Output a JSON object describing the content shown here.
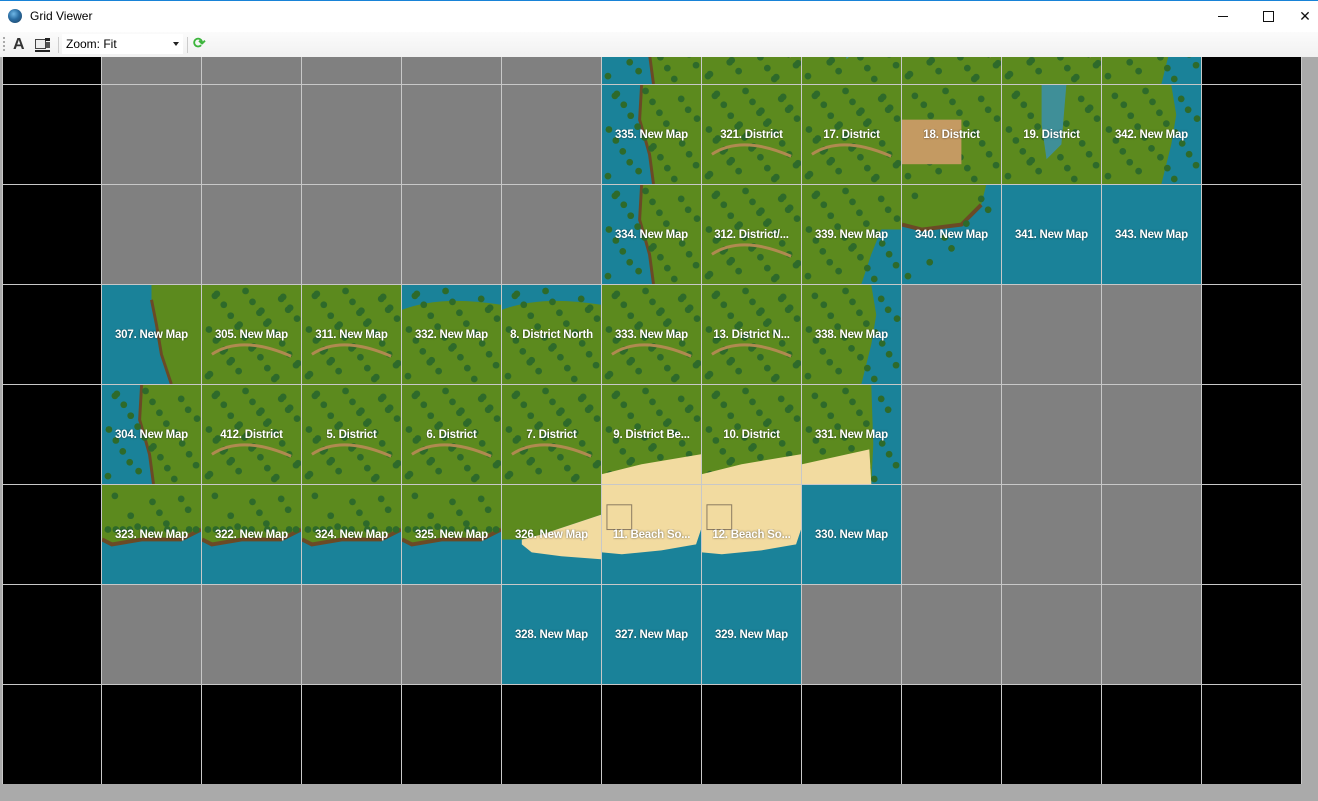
{
  "window": {
    "title": "Grid Viewer",
    "controls": {
      "minimize": "minimize",
      "maximize": "maximize",
      "close": "close"
    }
  },
  "toolbar": {
    "font_button_label": "A",
    "zoom_select_value": "Zoom: Fit",
    "icons": [
      "font-icon",
      "image-layout-icon",
      "refresh-icon"
    ]
  },
  "colors": {
    "title_accent": "#1883d7",
    "empty_cell": "#000000",
    "unused_cell": "#808080",
    "map_water": "#1a8299",
    "grid_line": "#c8c8c8",
    "grass": "#5c8a1e",
    "forest": "#2e6a2a",
    "sand": "#f2dba0",
    "label_text": "#ffffff"
  },
  "grid": {
    "columns": 13,
    "rows": [
      {
        "cells": [
          "black",
          "gray",
          "gray",
          "gray",
          "gray",
          "gray",
          {
            "type": "map",
            "land": "forest-coast-left"
          },
          {
            "type": "map",
            "land": "forest"
          },
          {
            "type": "map",
            "land": "forest-lake"
          },
          {
            "type": "map",
            "land": "forest"
          },
          {
            "type": "map",
            "land": "forest"
          },
          {
            "type": "map",
            "land": "forest-coast-right"
          },
          "black"
        ]
      },
      {
        "cells": [
          "black",
          "gray",
          "gray",
          "gray",
          "gray",
          "gray",
          {
            "type": "map",
            "label": "335. New Map",
            "land": "forest-coast-left"
          },
          {
            "type": "map",
            "label": "321. District",
            "land": "forest"
          },
          {
            "type": "map",
            "label": "17. District",
            "land": "forest"
          },
          {
            "type": "map",
            "label": "18. District",
            "land": "forest-dirt"
          },
          {
            "type": "map",
            "label": "19. District",
            "land": "forest-lake"
          },
          {
            "type": "map",
            "label": "342. New Map",
            "land": "forest-coast-right"
          },
          "black"
        ]
      },
      {
        "cells": [
          "black",
          "gray",
          "gray",
          "gray",
          "gray",
          "gray",
          {
            "type": "map",
            "label": "334. New Map",
            "land": "forest-coast-left"
          },
          {
            "type": "map",
            "label": "312. District/...",
            "land": "forest"
          },
          {
            "type": "map",
            "label": "339. New Map",
            "land": "forest-partial"
          },
          {
            "type": "map",
            "label": "340. New Map",
            "land": "coast-top"
          },
          {
            "type": "map",
            "label": "341. New Map",
            "land": "water"
          },
          {
            "type": "map",
            "label": "343. New Map",
            "land": "water"
          },
          "black"
        ]
      },
      {
        "cells": [
          "black",
          {
            "type": "map",
            "label": "307. New Map",
            "land": "coast-right"
          },
          {
            "type": "map",
            "label": "305. New Map",
            "land": "forest"
          },
          {
            "type": "map",
            "label": "311. New Map",
            "land": "forest"
          },
          {
            "type": "map",
            "label": "332. New Map",
            "land": "forest-coast-top"
          },
          {
            "type": "map",
            "label": "8. District North",
            "land": "forest-coast-top"
          },
          {
            "type": "map",
            "label": "333. New Map",
            "land": "forest"
          },
          {
            "type": "map",
            "label": "13. District N...",
            "land": "forest"
          },
          {
            "type": "map",
            "label": "338. New Map",
            "land": "forest-coast-right"
          },
          "gray",
          "gray",
          "gray",
          "black"
        ]
      },
      {
        "cells": [
          "black",
          {
            "type": "map",
            "label": "304. New Map",
            "land": "forest-coast-left"
          },
          {
            "type": "map",
            "label": "412. District",
            "land": "forest"
          },
          {
            "type": "map",
            "label": "5. District",
            "land": "forest"
          },
          {
            "type": "map",
            "label": "6. District",
            "land": "forest"
          },
          {
            "type": "map",
            "label": "7. District",
            "land": "forest"
          },
          {
            "type": "map",
            "label": "9. District Be...",
            "land": "forest-sand-bottom"
          },
          {
            "type": "map",
            "label": "10. District",
            "land": "forest-sand-bottom"
          },
          {
            "type": "map",
            "label": "331. New Map",
            "land": "forest-sand-coast"
          },
          "gray",
          "gray",
          "gray",
          "black"
        ]
      },
      {
        "cells": [
          "black",
          {
            "type": "map",
            "label": "323. New Map",
            "land": "forest-coast-bottom"
          },
          {
            "type": "map",
            "label": "322. New Map",
            "land": "forest-coast-bottom"
          },
          {
            "type": "map",
            "label": "324. New Map",
            "land": "forest-coast-bottom"
          },
          {
            "type": "map",
            "label": "325. New Map",
            "land": "forest-coast-bottom"
          },
          {
            "type": "map",
            "label": "326. New Map",
            "land": "forest-sand-coast-bottom"
          },
          {
            "type": "map",
            "label": "11. Beach So...",
            "land": "sand-coast-bottom"
          },
          {
            "type": "map",
            "label": "12. Beach So...",
            "land": "sand-coast-bottom"
          },
          {
            "type": "map",
            "label": "330. New Map",
            "land": "water"
          },
          "gray",
          "gray",
          "gray",
          "black"
        ]
      },
      {
        "cells": [
          "black",
          "gray",
          "gray",
          "gray",
          "gray",
          {
            "type": "map",
            "label": "328. New Map",
            "land": "water"
          },
          {
            "type": "map",
            "label": "327. New Map",
            "land": "water"
          },
          {
            "type": "map",
            "label": "329. New Map",
            "land": "water"
          },
          "gray",
          "gray",
          "gray",
          "gray",
          "black"
        ]
      },
      {
        "cells": [
          "black",
          "black",
          "black",
          "black",
          "black",
          "black",
          "black",
          "black",
          "black",
          "black",
          "black",
          "black",
          "black"
        ]
      }
    ]
  }
}
